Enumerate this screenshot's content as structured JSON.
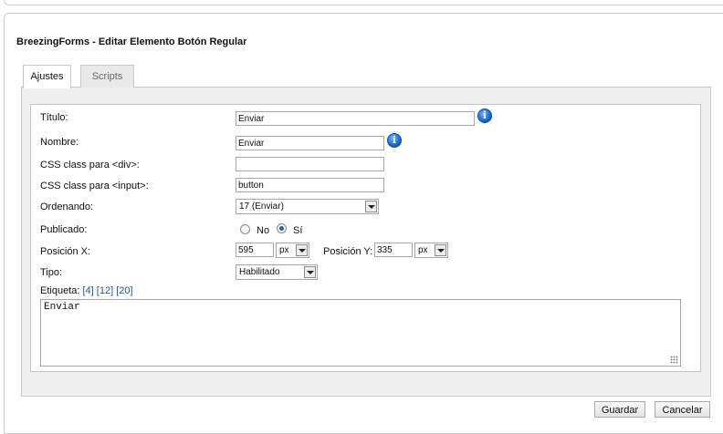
{
  "dialog": {
    "title": "BreezingForms - Editar Elemento Botón Regular"
  },
  "tabs": [
    {
      "label": "Ajustes",
      "active": true
    },
    {
      "label": "Scripts",
      "active": false
    }
  ],
  "form": {
    "titulo": {
      "label": "Título:",
      "value": "Enviar"
    },
    "nombre": {
      "label": "Nombre:",
      "value": "Enviar"
    },
    "css_div": {
      "label": "CSS class para <div>:",
      "value": ""
    },
    "css_input": {
      "label": "CSS class para <input>:",
      "value": "button"
    },
    "ordenando": {
      "label": "Ordenando:",
      "value": "17 (Enviar)"
    },
    "publicado": {
      "label": "Publicado:",
      "option_no": "No",
      "option_si": "Sí",
      "selected": "Sí"
    },
    "posicion_x": {
      "label": "Posición X:",
      "value": "595",
      "unit": "px"
    },
    "posicion_y": {
      "label": "Posición Y:",
      "value": "335",
      "unit": "px"
    },
    "tipo": {
      "label": "Tipo:",
      "value": "Habilitado"
    },
    "etiqueta": {
      "label": "Etiqueta:",
      "links": [
        "[4]",
        "[12]",
        "[20]"
      ],
      "value": "Enviar"
    }
  },
  "buttons": {
    "save": "Guardar",
    "cancel": "Cancelar"
  },
  "colors": {
    "link": "#1f57a5",
    "info_icon": "#0a5cc8",
    "tab_body_bg": "#f0f0f0"
  },
  "icons": {
    "info": "info-icon",
    "dropdown": "chevron-down-icon",
    "resize": "resize-grip-icon"
  }
}
